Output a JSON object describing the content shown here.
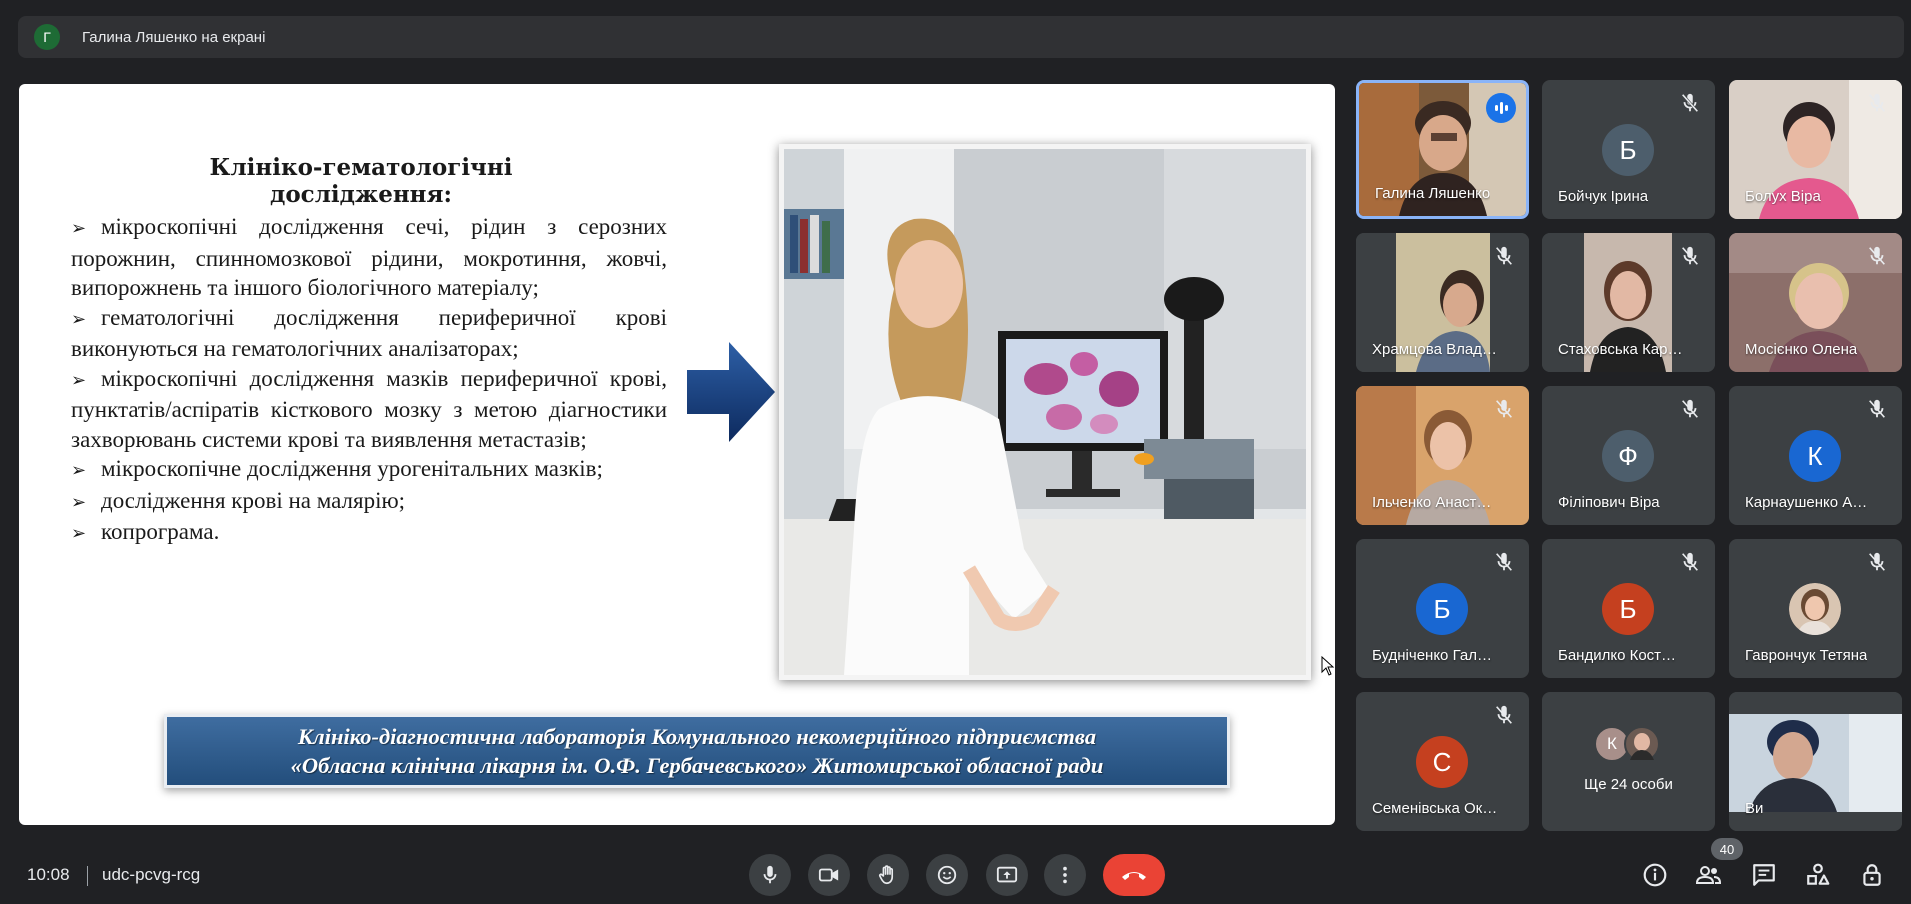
{
  "top_bar": {
    "avatar_letter": "Г",
    "title": "Галина Ляшенко на екрані"
  },
  "slide": {
    "heading": "Клініко-гематологічні дослідження:",
    "bullet_marker": "➢",
    "bullets": [
      "мікроскопічні дослідження сечі, рідин з серозних порожнин, спинномозкової рідини, мокротиння, жовчі, випорожнень та іншого біологічного матеріалу;",
      "гематологічні дослідження периферичної крові виконуються на гематологічних аналізаторах;",
      "мікроскопічні дослідження мазків периферичної крові, пунктатів/аспіратів кісткового мозку з метою діагностики захворювань системи крові та виявлення метастазів;",
      "мікроскопічне дослідження урогенітальних мазків;",
      "дослідження крові на малярію;",
      "копрограма."
    ],
    "banner_line1": "Клініко-діагностична лабораторія Комунального некомерційного підприємства",
    "banner_line2": "«Обласна клінічна лікарня ім. О.Ф. Гербачевського» Житомирської обласної ради"
  },
  "participants": [
    {
      "name": "Галина Ляшенко",
      "type": "video",
      "speaking": true
    },
    {
      "name": "Бойчук Ірина",
      "type": "letter",
      "letter": "Б",
      "color": "#4d5e6c",
      "muted": true
    },
    {
      "name": "Болух Віра",
      "type": "video",
      "muted": true
    },
    {
      "name": "Храмцова Влад…",
      "type": "video",
      "muted": true
    },
    {
      "name": "Стаховська Кар…",
      "type": "video",
      "muted": true
    },
    {
      "name": "Мосієнко Олена",
      "type": "video",
      "muted": true
    },
    {
      "name": "Ільченко Анаст…",
      "type": "video",
      "muted": true
    },
    {
      "name": "Філіпович Віра",
      "type": "letter",
      "letter": "Ф",
      "color": "#4d5e6c",
      "muted": true
    },
    {
      "name": "Карнаушенко А…",
      "type": "letter",
      "letter": "К",
      "color": "#1967d2",
      "muted": true
    },
    {
      "name": "Будніченко Гал…",
      "type": "letter",
      "letter": "Б",
      "color": "#1967d2",
      "muted": true
    },
    {
      "name": "Бандилко Кост…",
      "type": "letter",
      "letter": "Б",
      "color": "#c5401f",
      "muted": true
    },
    {
      "name": "Гаврончук Тетяна",
      "type": "photo",
      "muted": true
    },
    {
      "name": "Семенівська Ок…",
      "type": "letter",
      "letter": "С",
      "color": "#c5401f",
      "muted": true
    },
    {
      "name": "Ще 24 особи",
      "type": "more",
      "letter": "К"
    },
    {
      "name": "Ви",
      "type": "video"
    }
  ],
  "bottom_bar": {
    "time": "10:08",
    "meeting_code": "udc-pcvg-rcg",
    "people_count": "40"
  },
  "colors": {
    "background": "#202124",
    "tile": "#3c4043",
    "accent": "#8ab4f8",
    "hangup": "#ea4335"
  },
  "icons": [
    "mic-icon",
    "camera-icon",
    "raise-hand-icon",
    "emoji-icon",
    "present-icon",
    "more-options-icon",
    "hang-up-icon",
    "info-icon",
    "people-icon",
    "chat-icon",
    "activities-icon",
    "host-controls-icon",
    "mic-off-icon"
  ]
}
